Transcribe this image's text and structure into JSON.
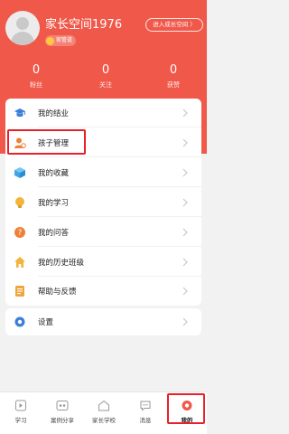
{
  "profile": {
    "username": "家长空间1976",
    "badge": "家管道",
    "growth_button": "进入成长空间 〉"
  },
  "stats": [
    {
      "value": "0",
      "label": "粉丝"
    },
    {
      "value": "0",
      "label": "关注"
    },
    {
      "value": "0",
      "label": "获赞"
    }
  ],
  "menu": [
    {
      "label": "我的结业",
      "icon": "graduation-cap-icon",
      "color": "#3c7fd9"
    },
    {
      "label": "孩子管理",
      "icon": "child-manage-icon",
      "color": "#f07f38"
    },
    {
      "label": "我的收藏",
      "icon": "box-icon",
      "color": "#3ca6e6"
    },
    {
      "label": "我的学习",
      "icon": "lightbulb-icon",
      "color": "#f3b43b"
    },
    {
      "label": "我的问答",
      "icon": "question-icon",
      "color": "#f07f38"
    },
    {
      "label": "我的历史班级",
      "icon": "home-icon",
      "color": "#f3b43b"
    },
    {
      "label": "帮助与反馈",
      "icon": "feedback-icon",
      "color": "#f3a33b"
    }
  ],
  "settings": {
    "label": "设置",
    "icon": "gear-icon",
    "color": "#3c7fd9"
  },
  "tabs": [
    {
      "label": "学习",
      "icon": "study-icon"
    },
    {
      "label": "案例分享",
      "icon": "case-share-icon"
    },
    {
      "label": "家长学校",
      "icon": "school-icon"
    },
    {
      "label": "消息",
      "icon": "message-icon"
    },
    {
      "label": "我的",
      "icon": "profile-icon",
      "active": true
    }
  ],
  "colors": {
    "header": "#f0584a",
    "highlight": "#e8202a"
  }
}
